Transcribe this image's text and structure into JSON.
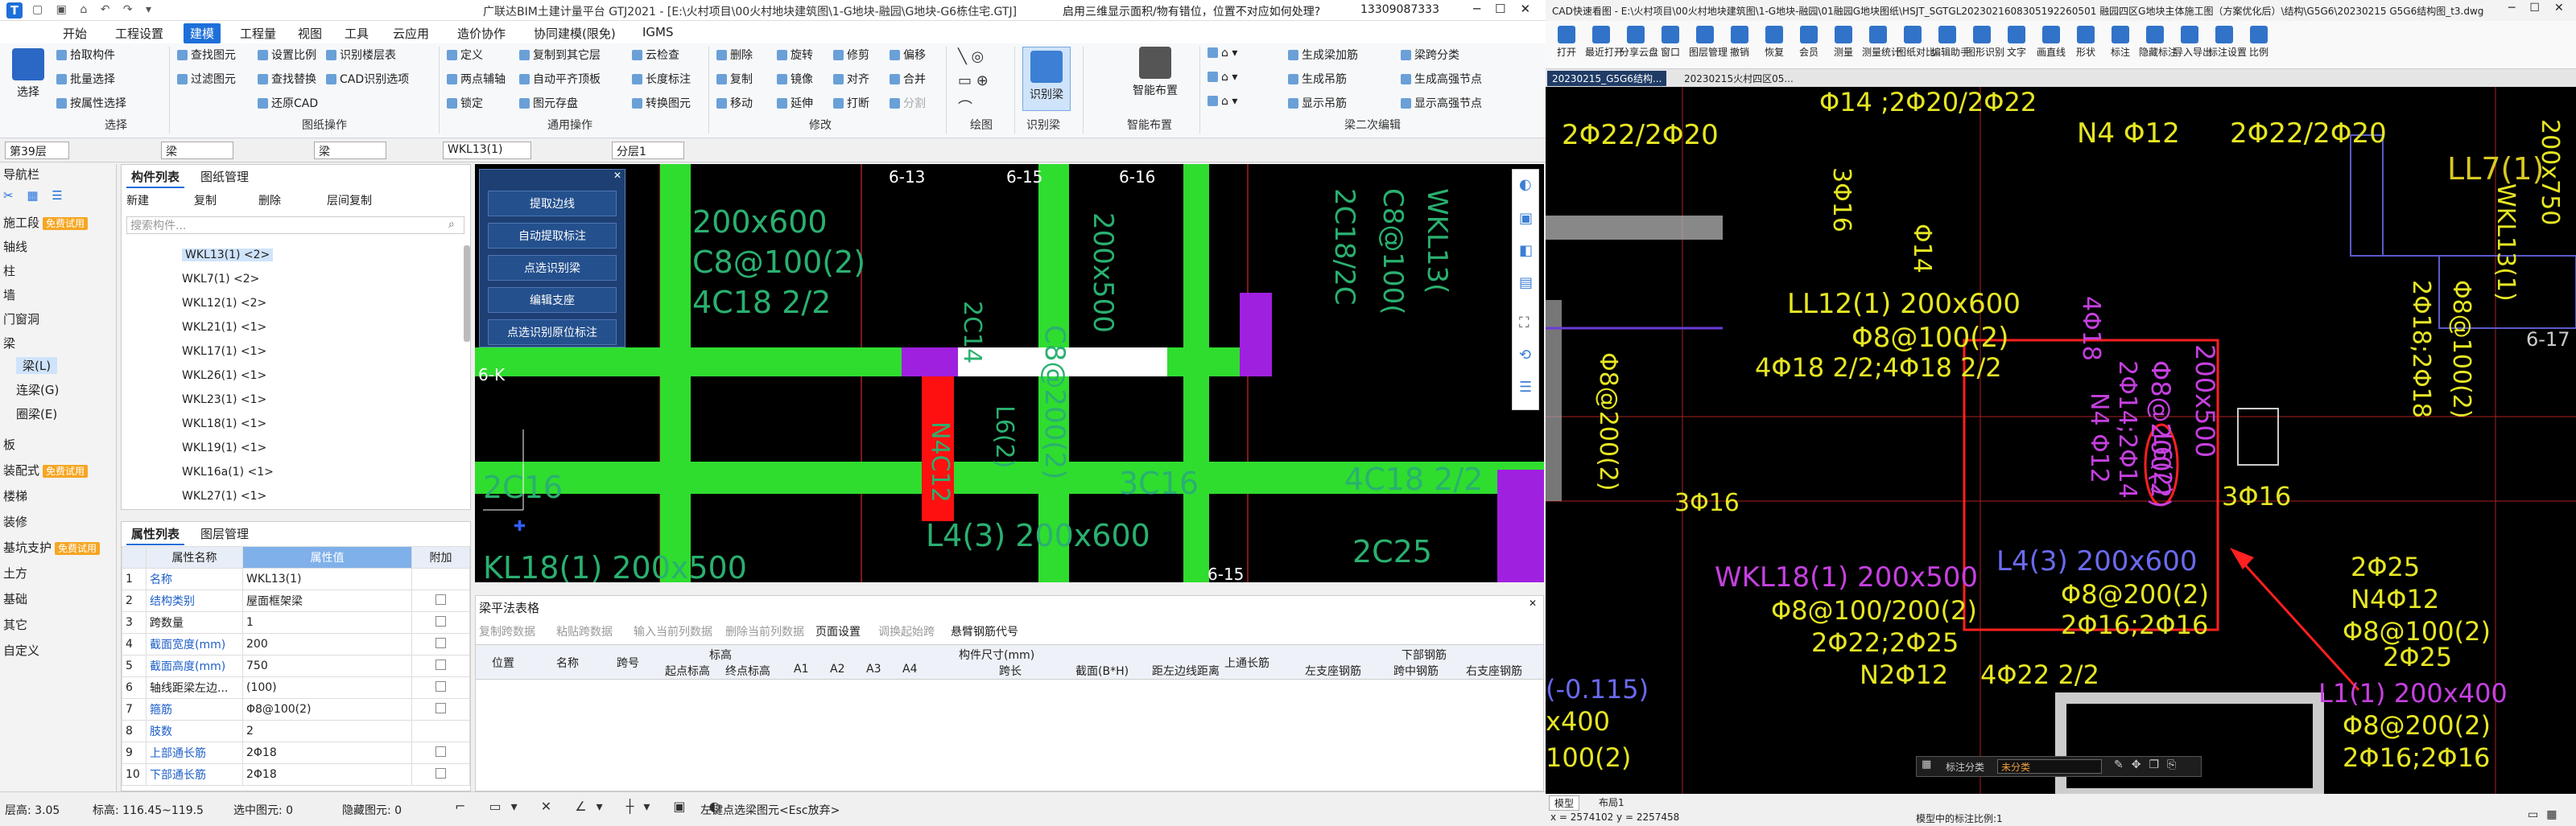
{
  "left_app": {
    "title": "广联达BIM土建计量平台 GTJ2021 - [E:\\火村项目\\00火村地块建筑图\\1-G地块-融园\\G地块-G6栋住宅.GTJ]",
    "notice": "启用三维显示面积/物有错位，位置不对应如何处理?",
    "user_phone": "13309087333",
    "menu": [
      "开始",
      "工程设置",
      "建模",
      "工程量",
      "视图",
      "工具",
      "云应用",
      "造价协作",
      "协同建模(限免)",
      "IGMS"
    ],
    "active_menu": "建模",
    "ribbon": {
      "select_group": {
        "label": "选择",
        "big": "选择",
        "items": [
          "拾取构件",
          "批量选择",
          "按属性选择"
        ]
      },
      "drawing_group": {
        "label": "图纸操作",
        "items": [
          "查找图元",
          "过滤图元",
          "设置比例",
          "查找替换",
          "还原CAD",
          "识别楼层表",
          "CAD识别选项"
        ]
      },
      "general_group": {
        "label": "通用操作",
        "items": [
          "定义",
          "复制到其它层",
          "两点辅轴",
          "云检查",
          "自动平齐顶板",
          "长度标注",
          "锁定",
          "图元存盘",
          "转换图元"
        ]
      },
      "modify_group": {
        "label": "修改",
        "items": [
          "删除",
          "旋转",
          "修剪",
          "偏移",
          "复制",
          "镜像",
          "对齐",
          "合并",
          "移动",
          "延伸",
          "打断",
          "分割"
        ]
      },
      "draw_group": {
        "label": "绘图"
      },
      "recognize_group": {
        "label": "识别梁",
        "big": "识别梁"
      },
      "smart_group": {
        "label": "智能布置",
        "big": "智能布置"
      },
      "beam_group": {
        "label": "梁二次编辑",
        "items": [
          "生成梁加筋",
          "生成吊筋",
          "显示吊筋",
          "梁跨分类",
          "生成高强节点",
          "显示高强节点"
        ]
      }
    },
    "selectors": {
      "floor": "第39层",
      "type": "梁",
      "sub": "梁",
      "comp": "WKL13(1)",
      "layer": "分层1"
    },
    "nav": {
      "title": "导航栏",
      "items": [
        {
          "label": "施工段",
          "free": "免费试用"
        },
        {
          "label": "轴线"
        },
        {
          "label": "柱"
        },
        {
          "label": "墙"
        },
        {
          "label": "门窗洞"
        },
        {
          "label": "梁"
        },
        {
          "label": "梁(L)"
        },
        {
          "label": "连梁(G)"
        },
        {
          "label": "圈梁(E)"
        },
        {
          "label": "板"
        },
        {
          "label": "装配式",
          "free": "免费试用"
        },
        {
          "label": "楼梯"
        },
        {
          "label": "装修"
        },
        {
          "label": "基坑支护",
          "free": "免费试用"
        },
        {
          "label": "土方"
        },
        {
          "label": "基础"
        },
        {
          "label": "其它"
        },
        {
          "label": "自定义"
        }
      ]
    },
    "comp_list": {
      "tabs": [
        "构件列表",
        "图纸管理"
      ],
      "toolbar": [
        "新建",
        "复制",
        "删除",
        "层间复制"
      ],
      "search_placeholder": "搜索构件...",
      "items": [
        "WKL13(1) <2>",
        "WKL7(1) <2>",
        "WKL12(1) <2>",
        "WKL21(1) <1>",
        "WKL17(1) <1>",
        "WKL26(1) <1>",
        "WKL23(1) <1>",
        "WKL18(1) <1>",
        "WKL19(1) <1>",
        "WKL16a(1) <1>",
        "WKL27(1) <1>"
      ],
      "selected": "WKL13(1) <2>"
    },
    "props": {
      "tabs": [
        "属性列表",
        "图层管理"
      ],
      "headers": [
        "属性名称",
        "属性值",
        "附加"
      ],
      "rows": [
        {
          "n": "1",
          "name": "名称",
          "val": "WKL13(1)",
          "blue": true,
          "cb": false
        },
        {
          "n": "2",
          "name": "结构类别",
          "val": "屋面框架梁",
          "blue": true,
          "cb": true
        },
        {
          "n": "3",
          "name": "跨数量",
          "val": "1",
          "blue": false,
          "cb": true
        },
        {
          "n": "4",
          "name": "截面宽度(mm)",
          "val": "200",
          "blue": true,
          "cb": true
        },
        {
          "n": "5",
          "name": "截面高度(mm)",
          "val": "750",
          "blue": true,
          "cb": true
        },
        {
          "n": "6",
          "name": "轴线距梁左边...",
          "val": "(100)",
          "blue": false,
          "cb": true
        },
        {
          "n": "7",
          "name": "箍筋",
          "val": "Φ8@100(2)",
          "blue": true,
          "cb": true
        },
        {
          "n": "8",
          "name": "肢数",
          "val": "2",
          "blue": true,
          "cb": false
        },
        {
          "n": "9",
          "name": "上部通长筋",
          "val": "2Φ18",
          "blue": true,
          "cb": true
        },
        {
          "n": "10",
          "name": "下部通长筋",
          "val": "2Φ18",
          "blue": true,
          "cb": true
        }
      ]
    },
    "float_panel": [
      "提取边线",
      "自动提取标注",
      "点选识别梁",
      "编辑支座",
      "点选识别原位标注"
    ],
    "cad_labels": {
      "axis_613": "6-13",
      "axis_615": "6-15",
      "axis_616": "6-16",
      "axis_615b": "6-15",
      "axis_6k": "6-K",
      "t1": "200x600",
      "t2": "C8@100(2)",
      "t3": "2C16",
      "t4": "4C18 2/2",
      "t5": "2C18/2C",
      "t6": "C8@100(",
      "t7": "WKL13(",
      "t8": "200x500",
      "t9": "C8@200(2)",
      "t10": "3C16",
      "t11": "4C18 2/2",
      "t12": "2C25",
      "t13": "L4(3) 200x600",
      "t14": "KL18(1) 200x500",
      "t15": "3C16",
      "t16": "N4C12",
      "t17": "L6(2)",
      "t18": "2C14"
    },
    "beam_table": {
      "title": "梁平法表格",
      "toolbar": [
        "复制跨数据",
        "粘贴跨数据",
        "输入当前列数据",
        "删除当前列数据",
        "页面设置",
        "调换起始跨",
        "悬臂钢筋代号"
      ],
      "h1": [
        "位置",
        "名称",
        "跨号",
        "标高",
        "构件尺寸(mm)",
        "上通长筋",
        "下部钢筋"
      ],
      "h2": [
        "起点标高",
        "终点标高",
        "A1",
        "A2",
        "A3",
        "A4",
        "跨长",
        "截面(B*H)",
        "距左边线距离",
        "左支座钢筋",
        "跨中钢筋",
        "右支座钢筋"
      ]
    },
    "status": {
      "floor_h": "层高: 3.05",
      "elev": "标高: 116.45~119.5",
      "selected": "选中图元: 0",
      "hidden": "隐藏图元: 0",
      "hint": "左键点选梁图元<Esc放弃>"
    }
  },
  "right_app": {
    "title": "CAD快速看图 - E:\\火村项目\\00火村地块建筑图\\1-G地块-融园\\01融园G地块图纸\\HSJT_SGTGL2023021608305192260501 融园四区G地块主体施工图（方案优化后）\\结构\\G5G6\\20230215 G5G6结构图_t3.dwg",
    "buttons": [
      "打开",
      "最近打开",
      "分享云盘",
      "窗口",
      "图层管理",
      "撤销",
      "恢复",
      "会员",
      "测量",
      "测量统计",
      "图纸对比",
      "编辑助手",
      "图形识别",
      "文字",
      "画直线",
      "形状",
      "标注",
      "隐藏标注",
      "导入导出",
      "标注设置",
      "比例"
    ],
    "doc_tabs": [
      "20230215_G5G6结构...",
      "20230215火村四区05..."
    ],
    "cad_labels": {
      "a": "2Φ22/2Φ20",
      "b": "Φ14 ;2Φ20/2Φ22",
      "c": "N4 Φ12",
      "d": "2Φ22/2Φ20",
      "e": "LL7(1)",
      "f": "200x750",
      "g": "WKL13(1)",
      "h": "2Φ18;2Φ18",
      "i": "Φ8@100(2)",
      "j": "6-17",
      "k": "LL12(1) 200x600",
      "l": "Φ8@100(2)",
      "m": "4Φ18 2/2;4Φ18 2/2",
      "n": "3Φ16",
      "o": "Φ14",
      "p": "200x500",
      "q": "Φ8@200(2)",
      "r": "N4 Φ12",
      "s": "2Φ14;2Φ14",
      "t": "L6(2)",
      "u": "4Φ18",
      "v": "3Φ16",
      "w": "L4(3) 200x600",
      "x": "Φ8@200(2)",
      "y": "2Φ16;2Φ16",
      "z": "2Φ25",
      "aa": "N4Φ12",
      "ab": "Φ8@100(2)",
      "ac": "WKL18(1) 200x500",
      "ad": "Φ8@100/200(2)",
      "ae": "2Φ22;2Φ25",
      "af": "N2Φ12",
      "ag": "4Φ22 2/2",
      "ah": "(-0.115)",
      "ai": "x400",
      "aj": "100(2)",
      "ak": "2Φ25",
      "al": "L1(1) 200x400",
      "am": "Φ8@200(2)",
      "an": "2Φ16;2Φ16",
      "ao": "3Φ16",
      "ap": "Φ8@200(2)"
    },
    "layer_bar": {
      "label": "标注分类",
      "value": "未分类"
    },
    "layout_tabs": [
      "模型",
      "布局1"
    ],
    "coords": "x = 2574102  y = 2257458",
    "scale_hint": "模型中的标注比例:1"
  }
}
